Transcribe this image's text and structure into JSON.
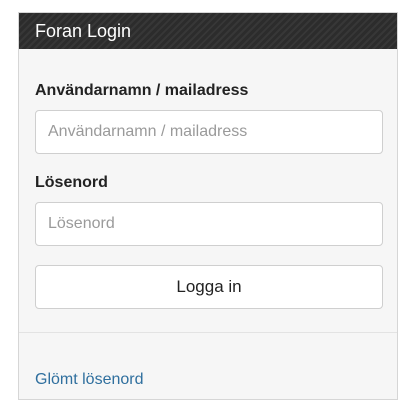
{
  "panel": {
    "title": "Foran Login"
  },
  "form": {
    "username_label": "Användarnamn / mailadress",
    "username_placeholder": "Användarnamn / mailadress",
    "username_value": "",
    "password_label": "Lösenord",
    "password_placeholder": "Lösenord",
    "password_value": "",
    "submit_label": "Logga in"
  },
  "footer": {
    "forgot_password_label": "Glömt lösenord"
  },
  "colors": {
    "header_background": "#2c2c2c",
    "link": "#2f6f9e",
    "panel_background": "#f6f6f6"
  }
}
